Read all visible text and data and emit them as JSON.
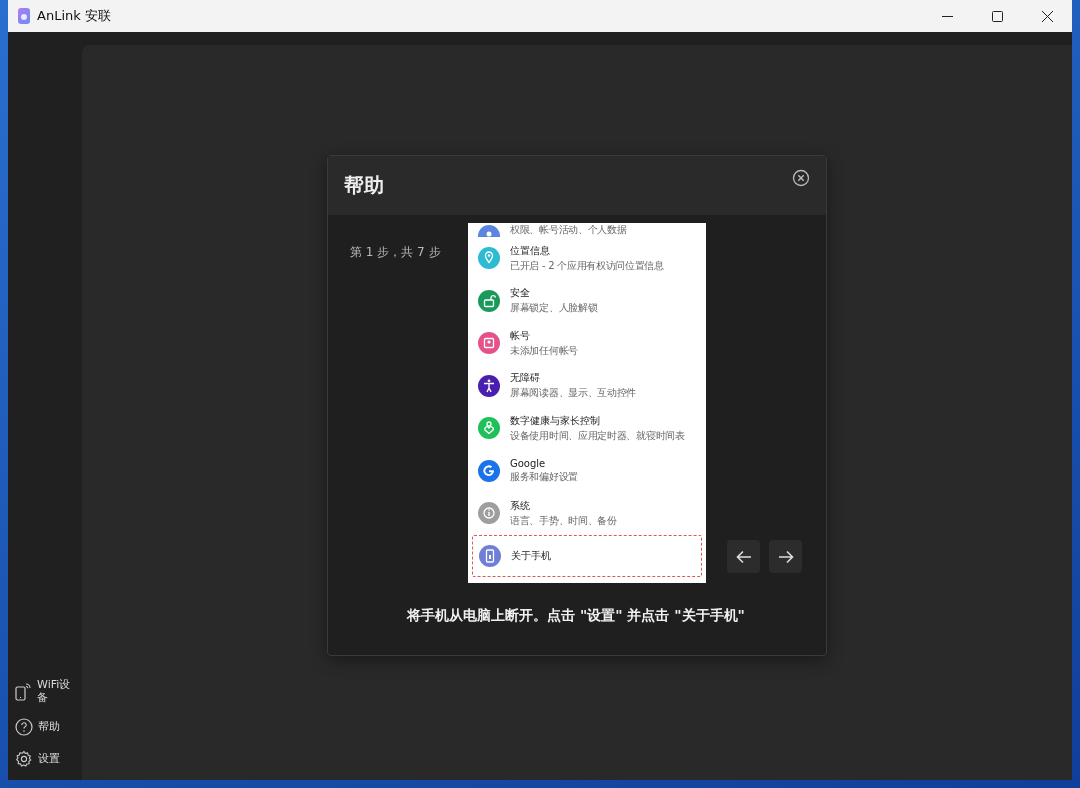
{
  "window": {
    "title": "AnLink 安联"
  },
  "sidebar": {
    "items": [
      {
        "kind": "wifi-device",
        "label": "WiFi设备"
      },
      {
        "kind": "help",
        "label": "帮助"
      },
      {
        "kind": "settings",
        "label": "设置"
      }
    ]
  },
  "dialog": {
    "title": "帮助",
    "step": "第 1 步，共 7 步",
    "phone_screen": {
      "items": [
        {
          "kind": "person",
          "subtitle": "权限、帐号活动、个人数据",
          "color": "#5b85e0",
          "highlighted": false
        },
        {
          "kind": "location",
          "title": "位置信息",
          "subtitle": "已开启 - 2 个应用有权访问位置信息",
          "color": "#2bbcd4",
          "highlighted": false
        },
        {
          "kind": "lock",
          "title": "安全",
          "subtitle": "屏幕锁定、人脸解锁",
          "color": "#1a9a5a",
          "highlighted": false
        },
        {
          "kind": "account",
          "title": "帐号",
          "subtitle": "未添加任何帐号",
          "color": "#e5528a",
          "highlighted": false
        },
        {
          "kind": "accessibility",
          "title": "无障碍",
          "subtitle": "屏幕阅读器、显示、互动控件",
          "color": "#4a1fb0",
          "highlighted": false
        },
        {
          "kind": "wellbeing",
          "title": "数字健康与家长控制",
          "subtitle": "设备使用时间、应用定时器、就寝时间表",
          "color": "#1fbf5a",
          "highlighted": false
        },
        {
          "kind": "google",
          "title": "Google",
          "subtitle": "服务和偏好设置",
          "color": "#1a73e8",
          "highlighted": false
        },
        {
          "kind": "info",
          "title": "系统",
          "subtitle": "语言、手势、时间、备份",
          "color": "#9e9e9e",
          "highlighted": false
        },
        {
          "kind": "phone",
          "title": "关于手机",
          "color": "#6f7fd6",
          "highlighted": true
        }
      ]
    },
    "instruction": "将手机从电脑上断开。点击 \"设置\" 并点击 \"关于手机\""
  }
}
